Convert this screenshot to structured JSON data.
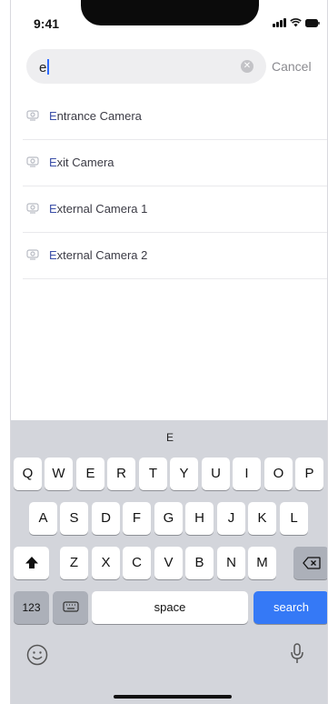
{
  "status_bar": {
    "time": "9:41"
  },
  "search": {
    "query": "e",
    "cancel_label": "Cancel"
  },
  "results": [
    {
      "prefix": "E",
      "rest": "ntrance Camera"
    },
    {
      "prefix": "E",
      "rest": "xit Camera"
    },
    {
      "prefix": "E",
      "rest": "xternal Camera 1"
    },
    {
      "prefix": "E",
      "rest": "xternal Camera 2"
    }
  ],
  "keyboard": {
    "suggestion": "E",
    "row1": [
      "Q",
      "W",
      "E",
      "R",
      "T",
      "Y",
      "U",
      "I",
      "O",
      "P"
    ],
    "row2": [
      "A",
      "S",
      "D",
      "F",
      "G",
      "H",
      "J",
      "K",
      "L"
    ],
    "row3": [
      "Z",
      "X",
      "C",
      "V",
      "B",
      "N",
      "M"
    ],
    "numbers_label": "123",
    "space_label": "space",
    "search_label": "search"
  },
  "icons": {
    "clear": "clear-icon",
    "camera": "camera-icon",
    "shift": "shift-icon",
    "delete": "delete-icon",
    "emoji_keyboard": "keyboard-icon",
    "emoji": "emoji-icon",
    "mic": "microphone-icon"
  },
  "colors": {
    "accent": "#3579f6",
    "highlight": "#3b4fa8"
  }
}
